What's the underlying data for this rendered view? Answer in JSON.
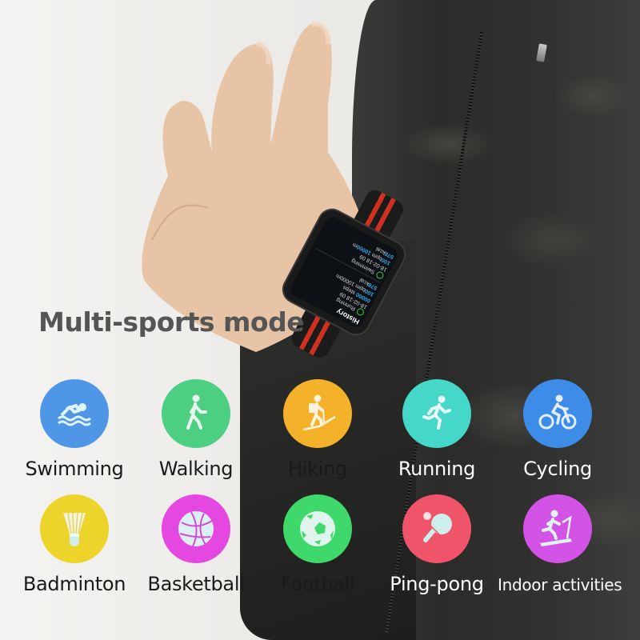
{
  "heading": "Multi-sports mode",
  "watch_screen": {
    "title": "History",
    "entries": [
      {
        "sport": "Running",
        "date": "18-02-18 09",
        "steps": "00000",
        "steps_unit": "steps",
        "distance": "10000",
        "distance_unit": "m",
        "heart_rate": "100",
        "heart_rate_unit": "bpm",
        "calories": "578",
        "calories_unit": "kcal"
      },
      {
        "sport": "Swimming",
        "date": "18-02-18 09",
        "distance": "10000",
        "distance_unit": "m",
        "heart_rate": "100",
        "heart_rate_unit": "bpm",
        "calories": "578",
        "calories_unit": "kcal"
      }
    ]
  },
  "sports": [
    {
      "label": "Swimming",
      "icon": "swimming-icon",
      "color": "#4f97e6"
    },
    {
      "label": "Walking",
      "icon": "walking-icon",
      "color": "#4ccf83"
    },
    {
      "label": "Hiking",
      "icon": "hiking-icon",
      "color": "#f3b229"
    },
    {
      "label": "Running",
      "icon": "running-icon",
      "color": "#45d8c9"
    },
    {
      "label": "Cycling",
      "icon": "cycling-icon",
      "color": "#3c8ce8"
    },
    {
      "label": "Badminton",
      "icon": "badminton-icon",
      "color": "#ecd42a"
    },
    {
      "label": "Basketball",
      "icon": "basketball-icon",
      "color": "#e448e0"
    },
    {
      "label": "Football",
      "icon": "football-icon",
      "color": "#3fd86a"
    },
    {
      "label": "Ping-pong",
      "icon": "ping-pong-icon",
      "color": "#f0546a"
    },
    {
      "label": "Indoor activities",
      "icon": "treadmill-icon",
      "color": "#d353e6"
    }
  ]
}
